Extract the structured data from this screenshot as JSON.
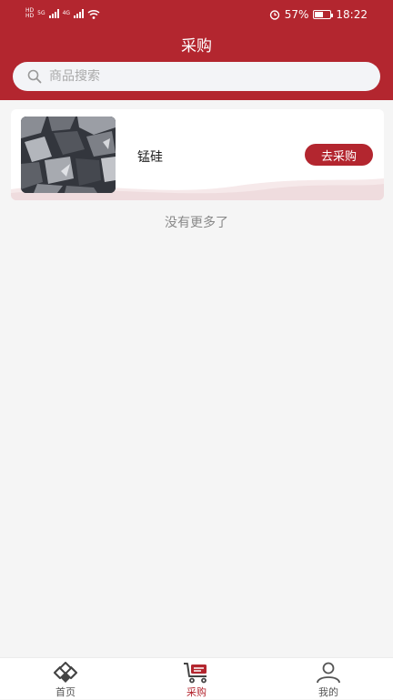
{
  "status_bar": {
    "network_1": "5G",
    "network_2": "4G",
    "battery_percent": "57%",
    "battery_level": 0.57,
    "time": "18:22"
  },
  "header": {
    "title": "采购"
  },
  "search": {
    "placeholder": "商品搜索"
  },
  "products": [
    {
      "name": "锰硅",
      "button_label": "去采购"
    }
  ],
  "list_footer": "没有更多了",
  "tabbar": {
    "items": [
      {
        "label": "首页",
        "icon": "home-icon",
        "active": false
      },
      {
        "label": "采购",
        "icon": "cart-icon",
        "active": true
      },
      {
        "label": "我的",
        "icon": "user-icon",
        "active": false
      }
    ]
  },
  "colors": {
    "brand": "#b3262f",
    "background": "#f5f5f5"
  }
}
